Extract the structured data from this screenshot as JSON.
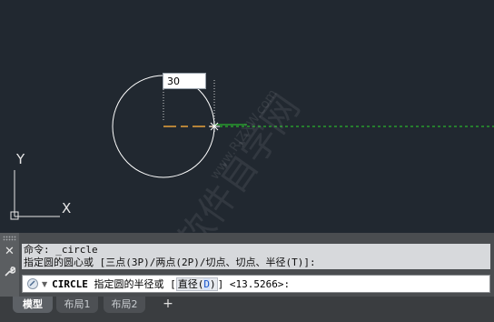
{
  "drawing": {
    "dynamic_input_value": "30",
    "ucs_x_label": "X",
    "ucs_y_label": "Y",
    "watermark_cn": "软件自学网",
    "watermark_url": "www.RJZXW.com"
  },
  "command": {
    "history": [
      "命令: _circle",
      "指定圆的圆心或 [三点(3P)/两点(2P)/切点、切点、半径(T)]:"
    ],
    "prompt_command": "CIRCLE",
    "prompt_text": "指定圆的半径或",
    "prompt_open": "[",
    "option_label": "直径(",
    "option_key": "D",
    "option_close": ")",
    "prompt_close": "]",
    "prompt_default": "<13.5266>:"
  },
  "layout_tabs": [
    "模型",
    "布局1",
    "布局2"
  ],
  "add_tab_label": "+",
  "colors": {
    "canvas_bg": "#212830",
    "crosshair_green": "#2bd32b",
    "radius_orange": "#e8a13a"
  }
}
